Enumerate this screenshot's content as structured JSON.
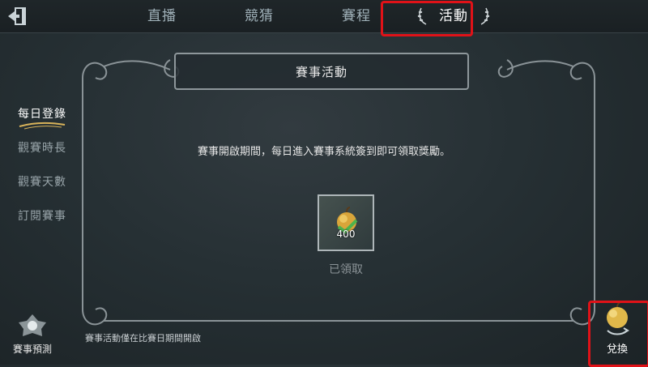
{
  "top_tabs": [
    {
      "label": "直播"
    },
    {
      "label": "競猜"
    },
    {
      "label": "賽程"
    },
    {
      "label": "活動"
    }
  ],
  "active_tab": "活動",
  "panel": {
    "title": "賽事活動",
    "description": "賽事開啟期間，每日進入賽事系統簽到即可領取獎勵。",
    "reward": {
      "icon": "apple-icon",
      "quantity": "400",
      "status": "已領取"
    },
    "footnote": "賽事活動僅在比賽日期間開啟"
  },
  "sidebar": {
    "items": [
      {
        "label": "每日登錄"
      },
      {
        "label": "觀賽時長"
      },
      {
        "label": "觀賽天數"
      },
      {
        "label": "訂閱賽事"
      }
    ],
    "active": "每日登錄"
  },
  "bottom_left": {
    "label": "賽事預測",
    "icon": "prediction-icon"
  },
  "bottom_right": {
    "label": "兌換",
    "icon": "exchange-apple-icon"
  },
  "colors": {
    "highlight": "#e01218",
    "accent_gold": "#e0b84a",
    "background": "#263034"
  }
}
